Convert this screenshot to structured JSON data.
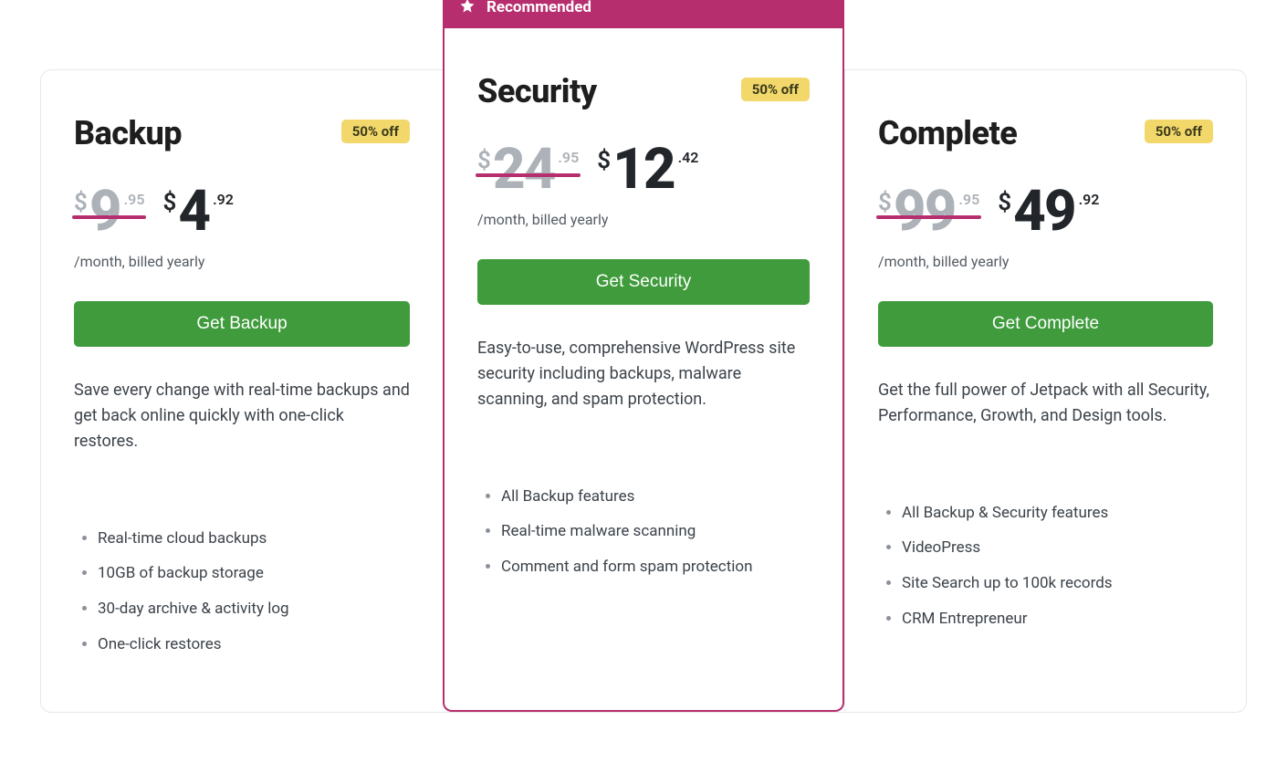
{
  "recommended_label": "Recommended",
  "billing_note": "/month, billed yearly",
  "plans": [
    {
      "name": "Backup",
      "discount": "50% off",
      "old_currency": "$",
      "old_whole": "9",
      "old_cents": ".95",
      "new_currency": "$",
      "new_whole": "4",
      "new_cents": ".92",
      "cta": "Get Backup",
      "description": "Save every change with real-time backups and get back online quickly with one-click restores.",
      "features": [
        "Real-time cloud backups",
        "10GB of backup storage",
        "30-day archive & activity log",
        "One-click restores"
      ]
    },
    {
      "name": "Security",
      "discount": "50% off",
      "old_currency": "$",
      "old_whole": "24",
      "old_cents": ".95",
      "new_currency": "$",
      "new_whole": "12",
      "new_cents": ".42",
      "cta": "Get Security",
      "description": "Easy-to-use, comprehensive WordPress site security including backups, malware scanning, and spam protection.",
      "features": [
        "All Backup features",
        "Real-time malware scanning",
        "Comment and form spam protection"
      ]
    },
    {
      "name": "Complete",
      "discount": "50% off",
      "old_currency": "$",
      "old_whole": "99",
      "old_cents": ".95",
      "new_currency": "$",
      "new_whole": "49",
      "new_cents": ".92",
      "cta": "Get Complete",
      "description": "Get the full power of Jetpack with all Security, Performance, Growth, and Design tools.",
      "features": [
        "All Backup & Security features",
        "VideoPress",
        "Site Search up to 100k records",
        "CRM Entrepreneur"
      ]
    }
  ]
}
